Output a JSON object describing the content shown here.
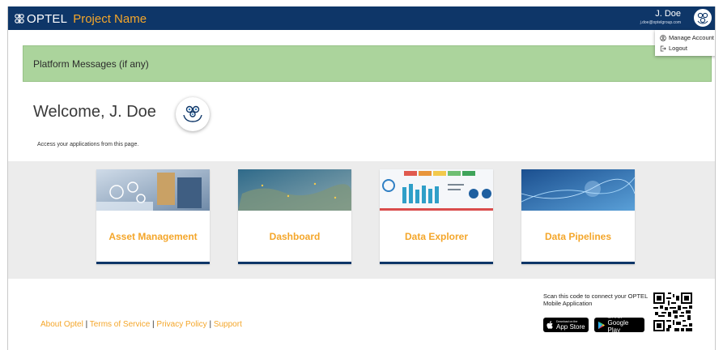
{
  "header": {
    "brand": "OPTEL",
    "project": "Project Name",
    "user_name": "J. Doe",
    "user_email": "j.doe@optelgroup.com"
  },
  "user_menu": {
    "items": [
      {
        "label": "Manage Account",
        "icon": "user-circle-icon"
      },
      {
        "label": "Logout",
        "icon": "logout-icon"
      }
    ]
  },
  "messages": {
    "text": "Platform Messages (if any)"
  },
  "welcome": {
    "title": "Welcome, J. Doe",
    "subtitle": "Access your applications from this page."
  },
  "apps": [
    {
      "label": "Asset Management",
      "image": "asset-management-thumbnail"
    },
    {
      "label": "Dashboard",
      "image": "dashboard-thumbnail"
    },
    {
      "label": "Data Explorer",
      "image": "data-explorer-thumbnail"
    },
    {
      "label": "Data Pipelines",
      "image": "data-pipelines-thumbnail"
    }
  ],
  "footer": {
    "links": [
      "About Optel",
      "Terms of Service",
      "Privacy Policy",
      "Support"
    ],
    "scan_text": "Scan this code to connect your OPTEL Mobile Application",
    "app_store": {
      "small": "Download on the",
      "big": "App Store"
    },
    "google_play": {
      "small": "GET IT ON",
      "big": "Google Play"
    }
  },
  "colors": {
    "primary": "#0e3668",
    "accent": "#f4a62a",
    "message_bg": "#abd49c",
    "band_bg": "#ececec"
  }
}
